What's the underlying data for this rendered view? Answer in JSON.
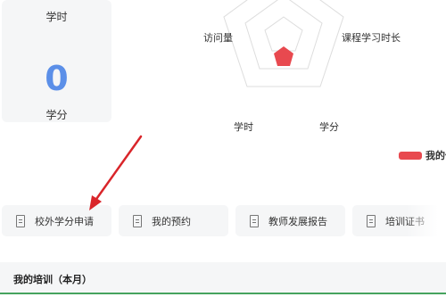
{
  "stats": {
    "hours_label": "学时",
    "credits_value": "0",
    "credits_label": "学分"
  },
  "radar": {
    "labels": {
      "visits": "访问量",
      "course_study_time": "课程学习时长",
      "hours": "学时",
      "credits": "学分"
    },
    "fill_color": "#e8494f"
  },
  "legend": {
    "label": "我的值",
    "color": "#e8494f"
  },
  "quick_actions": [
    {
      "label": "校外学分申请",
      "icon": "document-icon"
    },
    {
      "label": "我的预约",
      "icon": "calendar-icon"
    },
    {
      "label": "教师发展报告",
      "icon": "report-icon"
    },
    {
      "label": "培训证书",
      "icon": "certificate-icon"
    }
  ],
  "section": {
    "title": "我的培训（本月）",
    "accent_color": "#46a35e"
  },
  "annotation": {
    "arrow_color": "#d9252a"
  }
}
